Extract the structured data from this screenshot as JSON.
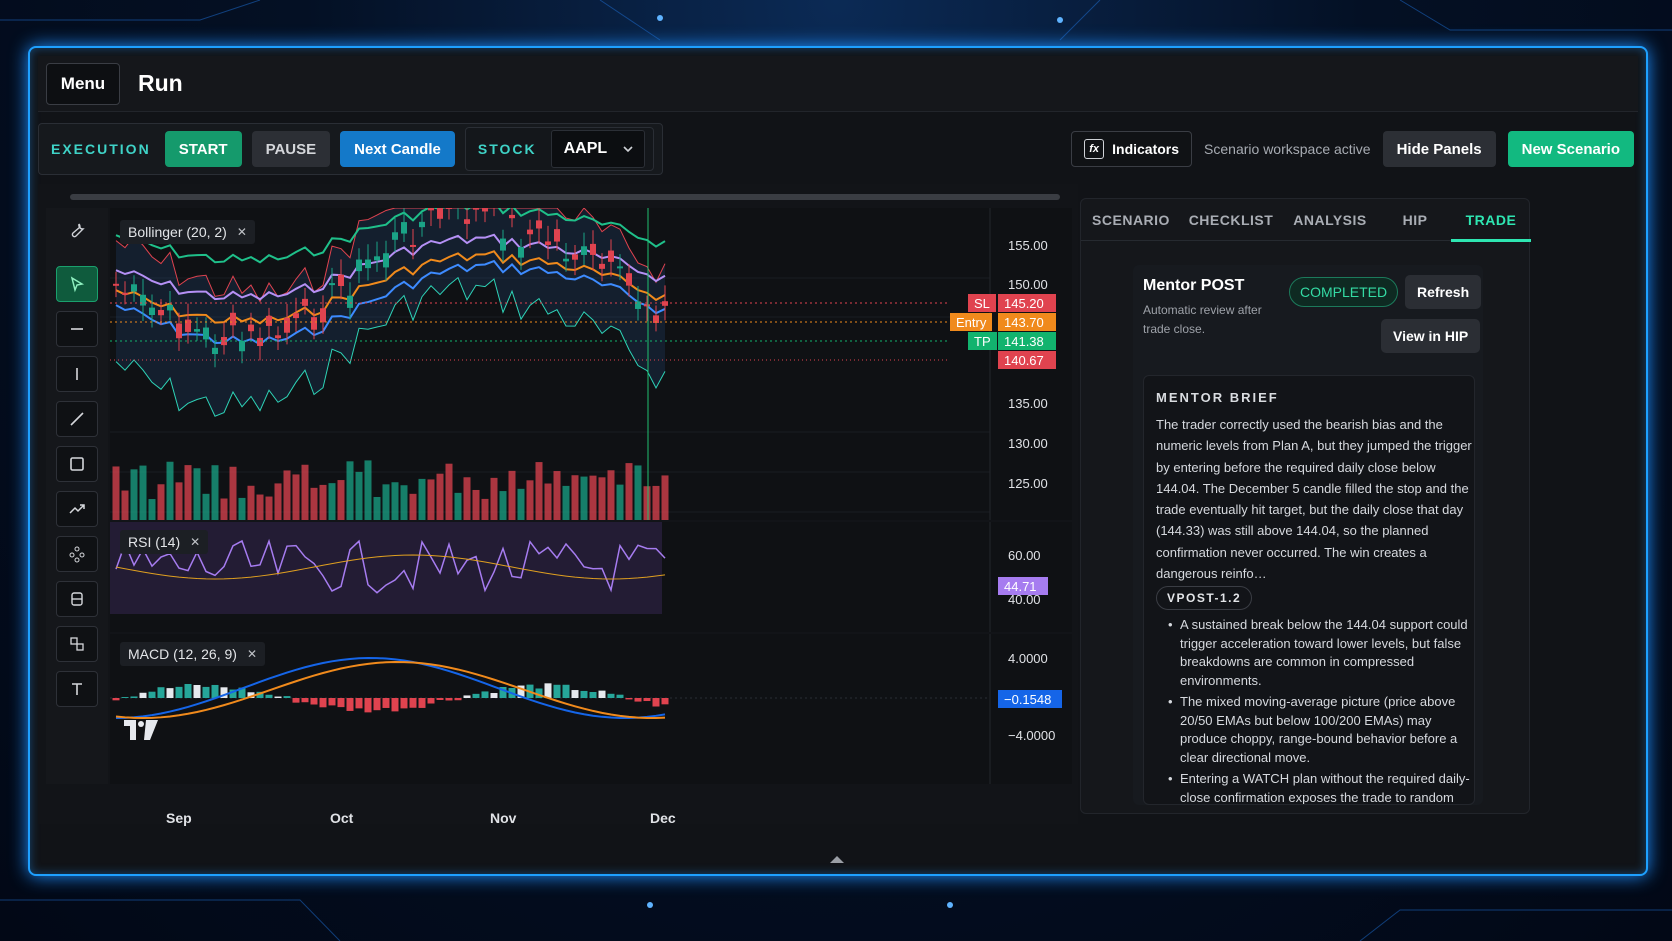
{
  "header": {
    "menu_label": "Menu",
    "title": "Run"
  },
  "toolbar": {
    "execution_label": "EXECUTION",
    "start_label": "START",
    "pause_label": "PAUSE",
    "next_candle_label": "Next Candle",
    "stock_label": "STOCK",
    "stock_value": "AAPL",
    "indicators_label": "Indicators",
    "status_text": "Scenario workspace active",
    "hide_panels_label": "Hide Panels",
    "new_scenario_label": "New Scenario"
  },
  "chart": {
    "legends": {
      "bollinger": "Bollinger (20, 2)",
      "rsi": "RSI (14)",
      "macd": "MACD (12, 26, 9)"
    },
    "price_ticks": [
      "155.00",
      "150.00",
      "135.00",
      "130.00",
      "125.00"
    ],
    "rsi_ticks": [
      "60.00",
      "40.00"
    ],
    "macd_ticks": [
      "4.0000",
      "−4.0000"
    ],
    "x_ticks": [
      "Sep",
      "Oct",
      "Nov",
      "Dec"
    ],
    "tags": {
      "sl_label": "SL",
      "sl_value": "145.20",
      "entry_label": "Entry",
      "entry_value": "143.70",
      "tp_label": "TP",
      "tp_value": "141.38",
      "last_value": "140.67",
      "rsi_value": "44.71",
      "macd_value": "−0.1548"
    },
    "colors": {
      "up": "#1aa386",
      "down": "#e0434f",
      "sl": "#e0434f",
      "entry": "#f08a1c",
      "tp": "#12b36e",
      "rsi": "#a67cf0",
      "macd": "#1565e8"
    }
  },
  "panel": {
    "tabs": [
      "SCENARIO",
      "CHECKLIST",
      "ANALYSIS",
      "HIP",
      "TRADE"
    ],
    "active_tab": "TRADE",
    "mentor": {
      "title": "Mentor POST",
      "subtitle": "Automatic review after trade close.",
      "status": "COMPLETED",
      "refresh_label": "Refresh",
      "view_hip_label": "View in HIP",
      "brief_heading": "MENTOR BRIEF",
      "brief_text": "The trader correctly used the bearish bias and the numeric levels from Plan A, but they jumped the trigger by entering before the required daily close below 144.04. The December 5 candle filled the stop and the trade eventually hit target, but the daily close that day (144.33) was still above 144.04, so the planned confirmation never occurred. The win creates a dangerous reinfo…",
      "version": "VPOST-1.2",
      "bullets": [
        "A sustained break below the 144.04 support could trigger acceleration toward lower levels, but false breakdowns are common in compressed environments.",
        "The mixed moving-average picture (price above 20/50 EMAs but below 100/200 EMAs) may produce choppy, range-bound behavior before a clear directional move.",
        "Entering a WATCH plan without the required daily-close confirmation exposes the trade to random intra-day noise and can degrade"
      ]
    }
  }
}
